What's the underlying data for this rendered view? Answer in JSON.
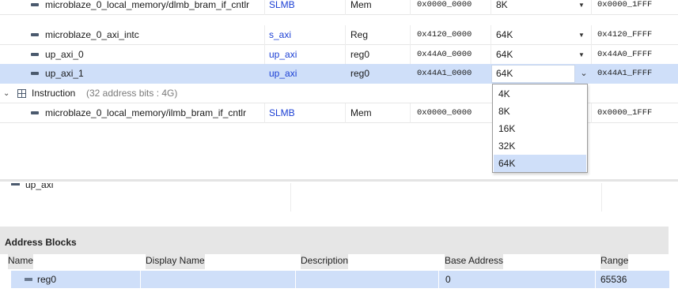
{
  "top_table": {
    "rows": [
      {
        "name": "microblaze_0_local_memory/dlmb_bram_if_cntlr",
        "interface": "SLMB",
        "block": "Mem",
        "offset": "0x0000_0000",
        "range": "8K",
        "high": "0x0000_1FFF"
      },
      {
        "name": "microblaze_0_axi_intc",
        "interface": "s_axi",
        "block": "Reg",
        "offset": "0x4120_0000",
        "range": "64K",
        "high": "0x4120_FFFF"
      },
      {
        "name": "up_axi_0",
        "interface": "up_axi",
        "block": "reg0",
        "offset": "0x44A0_0000",
        "range": "64K",
        "high": "0x44A0_FFFF"
      },
      {
        "name": "up_axi_1",
        "interface": "up_axi",
        "block": "reg0",
        "offset": "0x44A1_0000",
        "range": "64K",
        "high": "0x44A1_FFFF"
      }
    ],
    "instruction_group": {
      "label": "Instruction",
      "meta": "(32 address bits : 4G)"
    },
    "instruction_rows": [
      {
        "name": "microblaze_0_local_memory/ilmb_bram_if_cntlr",
        "interface": "SLMB",
        "block": "Mem",
        "offset": "0x0000_0000",
        "high": "0x0000_1FFF"
      }
    ],
    "range_options": [
      "4K",
      "8K",
      "16K",
      "32K",
      "64K"
    ],
    "range_selected": "64K"
  },
  "bottom": {
    "partial_item": "up_axi",
    "section_title": "Address Blocks",
    "columns": [
      "Name",
      "Display Name",
      "Description",
      "Base Address",
      "Range"
    ],
    "rows": [
      {
        "name": "reg0",
        "display_name": "",
        "description": "",
        "base_address": "0",
        "range": "65536"
      }
    ]
  },
  "colors": {
    "selection": "#cfdff9",
    "link": "#1b3fd4",
    "header_bg": "#e6e6e6"
  },
  "icons": {
    "port": "port-icon",
    "group": "grid-icon",
    "expand": "chevron-down-icon",
    "dropdown": "dropdown-arrow-icon"
  }
}
